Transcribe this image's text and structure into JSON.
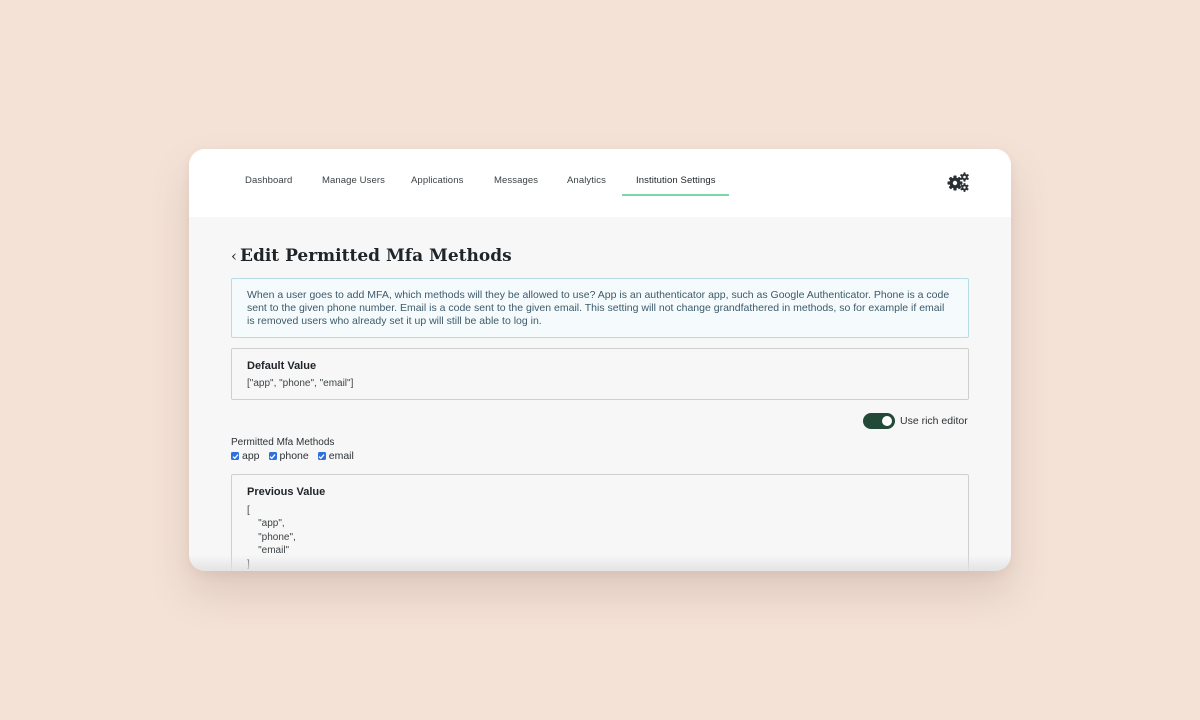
{
  "nav": {
    "items": [
      {
        "label": "Dashboard"
      },
      {
        "label": "Manage Users"
      },
      {
        "label": "Applications"
      },
      {
        "label": "Messages"
      },
      {
        "label": "Analytics"
      },
      {
        "label": "Institution Settings",
        "active": true
      }
    ],
    "settings_icon": "gears-icon"
  },
  "page": {
    "back_icon": "chevron-left-icon",
    "title": "Edit Permitted Mfa Methods",
    "description": "When a user goes to add MFA, which methods will they be allowed to use? App is an authenticator app, such as Google Authenticator. Phone is a code sent to the given phone number. Email is a code sent to the given email. This setting will not change grandfathered in methods, so for example if email is removed users who already set it up will still be able to log in."
  },
  "default_value": {
    "title": "Default Value",
    "value": "[\"app\", \"phone\", \"email\"]"
  },
  "rich_editor": {
    "label": "Use rich editor",
    "enabled": true
  },
  "field": {
    "label": "Permitted Mfa Methods",
    "options": [
      {
        "label": "app",
        "checked": true
      },
      {
        "label": "phone",
        "checked": true
      },
      {
        "label": "email",
        "checked": true
      }
    ]
  },
  "previous_value": {
    "title": "Previous Value",
    "value": "[\n    \"app\",\n    \"phone\",\n    \"email\"\n]"
  },
  "colors": {
    "page_background": "#f4e2d7",
    "active_tab_underline": "#7ed6a8",
    "toggle_on": "#234a38",
    "checkbox": "#2f6fe0",
    "info_border": "#b6dce4"
  }
}
